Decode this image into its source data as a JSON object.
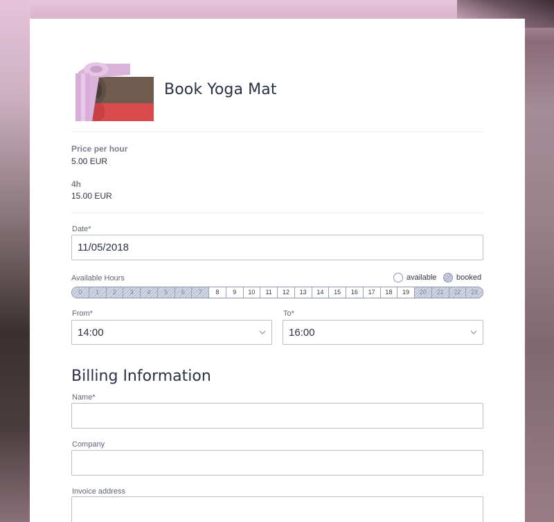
{
  "product": {
    "title": "Book Yoga Mat",
    "image_icon": "yoga-mat-image"
  },
  "pricing": {
    "price_label": "Price per hour",
    "price_value": "5.00 EUR",
    "duration_label": "4h",
    "total_value": "15.00 EUR"
  },
  "date": {
    "label": "Date*",
    "value": "11/05/2018"
  },
  "available_hours": {
    "label": "Available Hours",
    "legend_available": "available",
    "legend_booked": "booked",
    "hours": [
      "0",
      "1",
      "2",
      "3",
      "4",
      "5",
      "6",
      "7",
      "8",
      "9",
      "10",
      "11",
      "12",
      "13",
      "14",
      "15",
      "16",
      "17",
      "18",
      "19",
      "20",
      "21",
      "22",
      "23"
    ],
    "booked_hours": [
      0,
      1,
      2,
      3,
      4,
      5,
      6,
      7,
      20,
      21,
      22,
      23
    ]
  },
  "from": {
    "label": "From*",
    "value": "14:00"
  },
  "to": {
    "label": "To*",
    "value": "16:00"
  },
  "billing": {
    "title": "Billing Information",
    "name_label": "Name*",
    "name_value": "",
    "company_label": "Company",
    "company_value": "",
    "address_label": "Invoice address",
    "address_value": ""
  },
  "colors": {
    "booked_hatch": "#aab0c8",
    "border": "#b9bcc4",
    "text": "#2b3142"
  }
}
